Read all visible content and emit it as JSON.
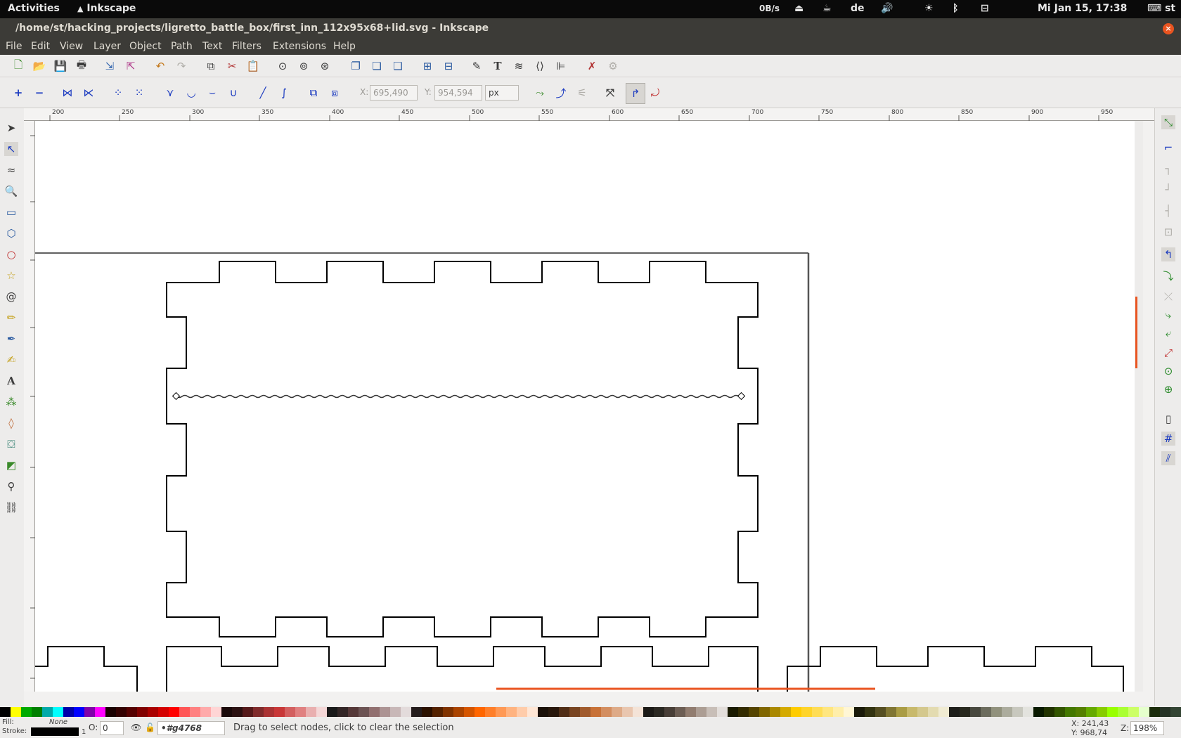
{
  "topbar": {
    "activities": "Activities",
    "app": "Inkscape",
    "net": "0B/s",
    "keyboard": "de",
    "clock": "Mi Jan 15, 17:38",
    "user": "st"
  },
  "window": {
    "title": "/home/st/hacking_projects/ligretto_battle_box/first_inn_112x95x68+lid.svg - Inkscape",
    "close": "×"
  },
  "menu": [
    "File",
    "Edit",
    "View",
    "Layer",
    "Object",
    "Path",
    "Text",
    "Filters",
    "Extensions",
    "Help"
  ],
  "controls": {
    "x_label": "X:",
    "x_value": "695,490",
    "y_label": "Y:",
    "y_value": "954,594",
    "unit": "px"
  },
  "ruler": {
    "top": [
      "200",
      "250",
      "300",
      "350",
      "400",
      "450",
      "500",
      "550",
      "600",
      "650",
      "700",
      "750",
      "800",
      "850",
      "900",
      "950"
    ],
    "left": [
      "-50",
      "100",
      "150",
      "200",
      "250",
      "300",
      "350",
      "400",
      "450",
      "500",
      "550",
      "600",
      "650",
      "700",
      "750"
    ]
  },
  "status": {
    "fill_label": "Fill:",
    "fill_value": "None",
    "stroke_label": "Stroke:",
    "stroke_width": "1",
    "opacity_label": "O:",
    "opacity_value": "0",
    "layer": "•#g4768",
    "message": "Drag to select nodes, click to clear the selection",
    "cursor_x": "X: 241,43",
    "cursor_y": "Y: 968,74",
    "zoom_label": "Z:",
    "zoom": "198%"
  },
  "colors": {
    "accent": "#e95420",
    "titlebar": "#3c3b37",
    "topbar": "#0a0a0a"
  },
  "palette": [
    "#000000",
    "#ffff00",
    "#00aa00",
    "#008000",
    "#00aaaa",
    "#00ffff",
    "#0000aa",
    "#0000ff",
    "#8000aa",
    "#ff00ff",
    "#1a0000",
    "#330000",
    "#550000",
    "#800000",
    "#aa0000",
    "#d40000",
    "#ff0000",
    "#ff5555",
    "#ff8080",
    "#ffaaaa",
    "#ffd5d5",
    "#1a0a0a",
    "#2b1111",
    "#551a1a",
    "#802b2b",
    "#aa3333",
    "#c83737",
    "#d35f5f",
    "#e08080",
    "#e9afaf",
    "#f4d7d7",
    "#1a1a1a",
    "#332626",
    "#553838",
    "#6c5353",
    "#916f6f",
    "#ac9393",
    "#c8b7b7",
    "#e3dbdb",
    "#241c1c",
    "#2b1100",
    "#552200",
    "#803300",
    "#aa4400",
    "#d45500",
    "#ff6600",
    "#ff7f2a",
    "#ff9955",
    "#ffb380",
    "#ffccaa",
    "#ffe6d5",
    "#1a1008",
    "#28170b",
    "#502d16",
    "#784421",
    "#a05a2c",
    "#c87137",
    "#d38d5f",
    "#deaa87",
    "#e9c6af",
    "#f4e3d7",
    "#1c1a17",
    "#2b2822",
    "#483e37",
    "#6c5d53",
    "#917c6f",
    "#ac9d93",
    "#c8beb7",
    "#e3dedb",
    "#1a1a00",
    "#332b00",
    "#554400",
    "#806600",
    "#aa8800",
    "#d4aa00",
    "#ffcc00",
    "#ffd42a",
    "#ffdd55",
    "#ffe680",
    "#ffeeaa",
    "#fff6d5",
    "#1a1a0a",
    "#333311",
    "#554e22",
    "#807533",
    "#aa9c44",
    "#c8b96b",
    "#d4c88d",
    "#e3dbb0",
    "#f0ebd2",
    "#1e1e1a",
    "#28281e",
    "#48483e",
    "#6c6c5d",
    "#91917c",
    "#acac9d",
    "#c8c8be",
    "#e3e3de",
    "#0a1a00",
    "#223300",
    "#335500",
    "#447800",
    "#558000",
    "#66aa00",
    "#88cc00",
    "#99ff00",
    "#aaff33",
    "#ccff66",
    "#e5ffcc",
    "#1a2b0a",
    "#263326",
    "#334433"
  ]
}
